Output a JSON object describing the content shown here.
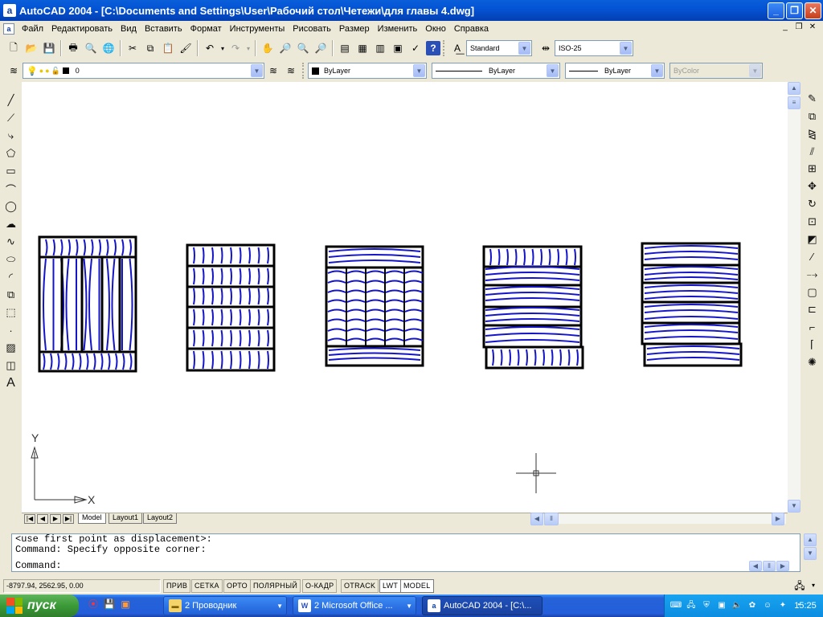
{
  "window": {
    "title": "AutoCAD 2004 - [C:\\Documents and Settings\\User\\Рабочий стол\\Четежи\\для главы 4.dwg]"
  },
  "menu": [
    "Файл",
    "Редактировать",
    "Вид",
    "Вставить",
    "Формат",
    "Инструменты",
    "Рисовать",
    "Размер",
    "Изменить",
    "Окно",
    "Справка"
  ],
  "styles": {
    "text_style": "Standard",
    "dim_style": "ISO-25"
  },
  "layers": {
    "current_layer": "0",
    "color": "ByLayer",
    "linetype": "ByLayer",
    "lineweight": "ByLayer",
    "plot_style": "ByColor"
  },
  "drawing": {
    "stroke_color": "#1414c8",
    "frame_color": "#000000"
  },
  "ucs": {
    "x_label": "X",
    "y_label": "Y"
  },
  "layout_tabs": [
    "Model",
    "Layout1",
    "Layout2"
  ],
  "command_lines": [
    "<use first point as displacement>:",
    "Command: Specify opposite corner:",
    "Command:"
  ],
  "status": {
    "coords": "-8797.94, 2562.95, 0.00",
    "toggles": [
      "ПРИВ",
      "СЕТКА",
      "ОРТО",
      "ПОЛЯРНЫЙ",
      "О-КАДР",
      "OTRACK",
      "LWT",
      "MODEL"
    ]
  },
  "taskbar": {
    "start_label": "пуск",
    "tasks": [
      {
        "label": "2 Проводник",
        "icon": "folder-icon"
      },
      {
        "label": "2 Microsoft Office ...",
        "icon": "word-icon"
      },
      {
        "label": "AutoCAD 2004 - [C:\\...",
        "icon": "autocad-icon"
      }
    ],
    "clock": "15:25"
  }
}
